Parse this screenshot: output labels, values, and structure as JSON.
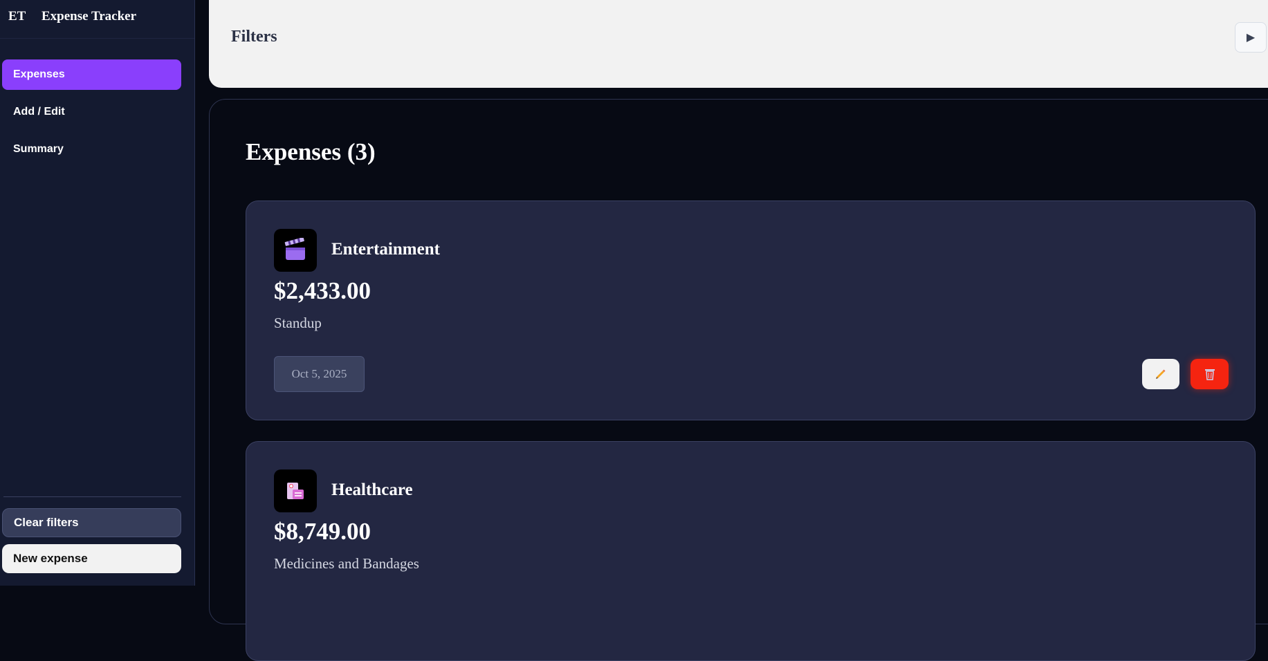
{
  "app": {
    "logo_text": "ET",
    "title": "Expense Tracker"
  },
  "sidebar": {
    "items": [
      {
        "label": "Expenses",
        "active": true
      },
      {
        "label": "Add / Edit",
        "active": false
      },
      {
        "label": "Summary",
        "active": false
      }
    ],
    "clear_filters_label": "Clear filters",
    "new_expense_label": "New expense"
  },
  "filters": {
    "title": "Filters",
    "toggle_icon": "▶"
  },
  "expenses": {
    "title": "Expenses (3)",
    "cards": [
      {
        "category": "Entertainment",
        "icon": "clapperboard-icon",
        "amount": "$2,433.00",
        "description": "Standup",
        "date": "Oct 5, 2025"
      },
      {
        "category": "Healthcare",
        "icon": "hospital-icon",
        "amount": "$8,749.00",
        "description": "Medicines and Bandages",
        "date": ""
      }
    ]
  },
  "colors": {
    "accent": "#8a3ffc",
    "danger": "#f52410",
    "card_bg": "#232742",
    "sidebar_bg": "#141a30"
  }
}
